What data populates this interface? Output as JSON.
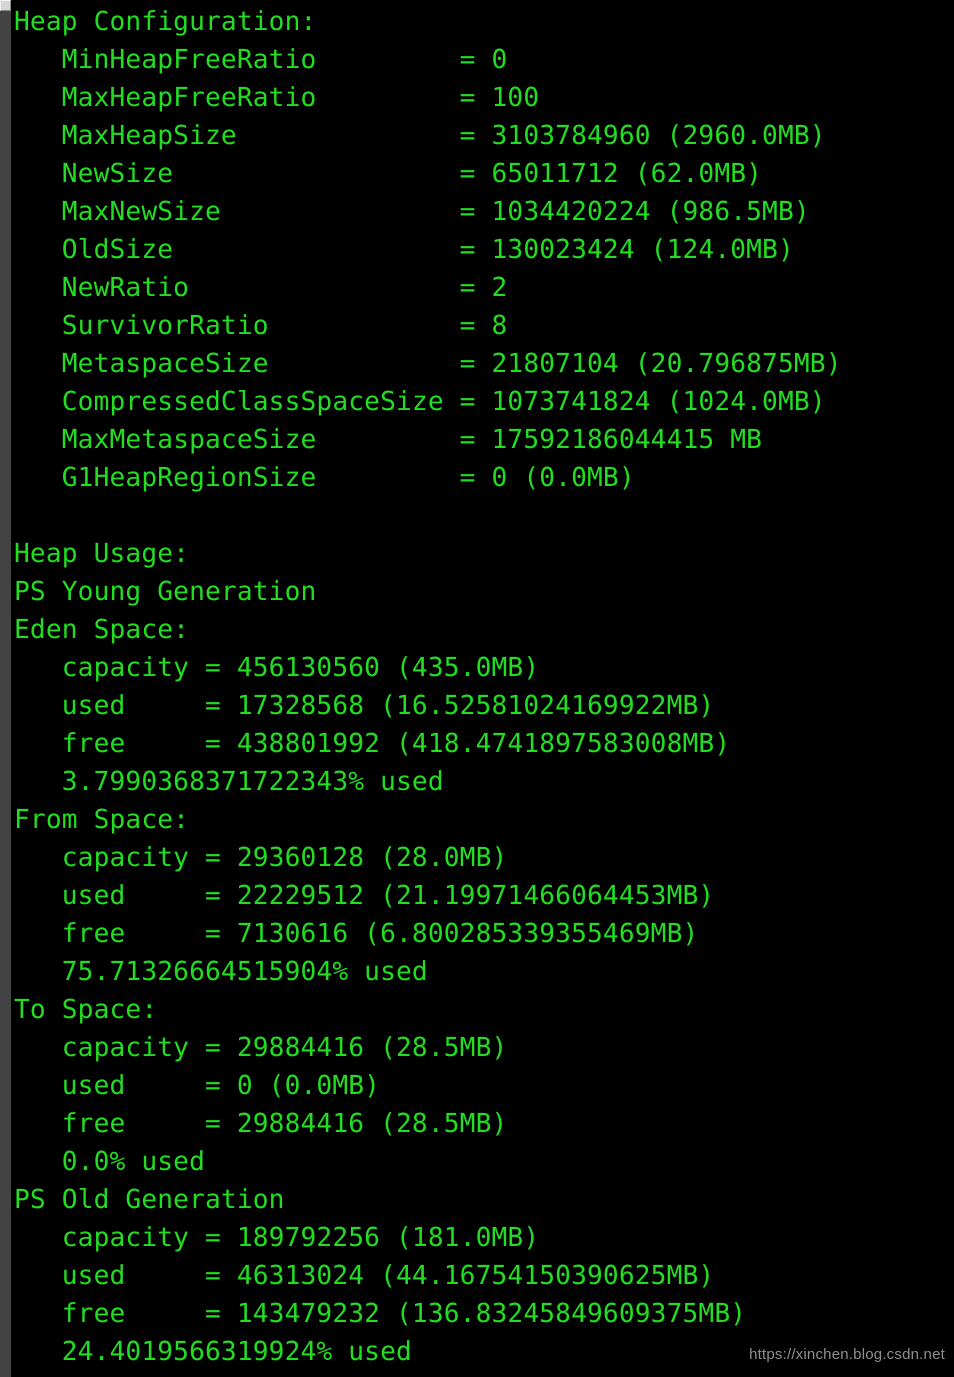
{
  "window": {
    "background_color": "#000000",
    "text_color": "#22dd22",
    "gutter_color": "#434343",
    "scrollbar_button_color": "#d6d6d6"
  },
  "heap_configuration": {
    "heading": "Heap Configuration:",
    "entries": [
      {
        "name": "MinHeapFreeRatio",
        "value": "0"
      },
      {
        "name": "MaxHeapFreeRatio",
        "value": "100"
      },
      {
        "name": "MaxHeapSize",
        "value": "3103784960 (2960.0MB)"
      },
      {
        "name": "NewSize",
        "value": "65011712 (62.0MB)"
      },
      {
        "name": "MaxNewSize",
        "value": "1034420224 (986.5MB)"
      },
      {
        "name": "OldSize",
        "value": "130023424 (124.0MB)"
      },
      {
        "name": "NewRatio",
        "value": "2"
      },
      {
        "name": "SurvivorRatio",
        "value": "8"
      },
      {
        "name": "MetaspaceSize",
        "value": "21807104 (20.796875MB)"
      },
      {
        "name": "CompressedClassSpaceSize",
        "value": "1073741824 (1024.0MB)"
      },
      {
        "name": "MaxMetaspaceSize",
        "value": "17592186044415 MB"
      },
      {
        "name": "G1HeapRegionSize",
        "value": "0 (0.0MB)"
      }
    ]
  },
  "heap_usage": {
    "heading": "Heap Usage:",
    "generations": [
      {
        "name": "PS Young Generation",
        "spaces": [
          {
            "label": "Eden Space:",
            "capacity": "456130560 (435.0MB)",
            "used": "17328568 (16.52581024169922MB)",
            "free": "438801992 (418.4741897583008MB)",
            "percent_used": "3.7990368371722343% used"
          },
          {
            "label": "From Space:",
            "capacity": "29360128 (28.0MB)",
            "used": "22229512 (21.19971466064453MB)",
            "free": "7130616 (6.800285339355469MB)",
            "percent_used": "75.71326664515904% used"
          },
          {
            "label": "To Space:",
            "capacity": "29884416 (28.5MB)",
            "used": "0 (0.0MB)",
            "free": "29884416 (28.5MB)",
            "percent_used": "0.0% used"
          }
        ]
      },
      {
        "name": "PS Old Generation",
        "spaces": [
          {
            "label": "",
            "capacity": "189792256 (181.0MB)",
            "used": "46313024 (44.16754150390625MB)",
            "free": "143479232 (136.83245849609375MB)",
            "percent_used": "24.4019566319924% used"
          }
        ]
      }
    ],
    "field_labels": {
      "capacity": "capacity",
      "used": "used",
      "free": "free"
    }
  },
  "watermark": {
    "text": "https://xinchen.blog.csdn.net"
  }
}
